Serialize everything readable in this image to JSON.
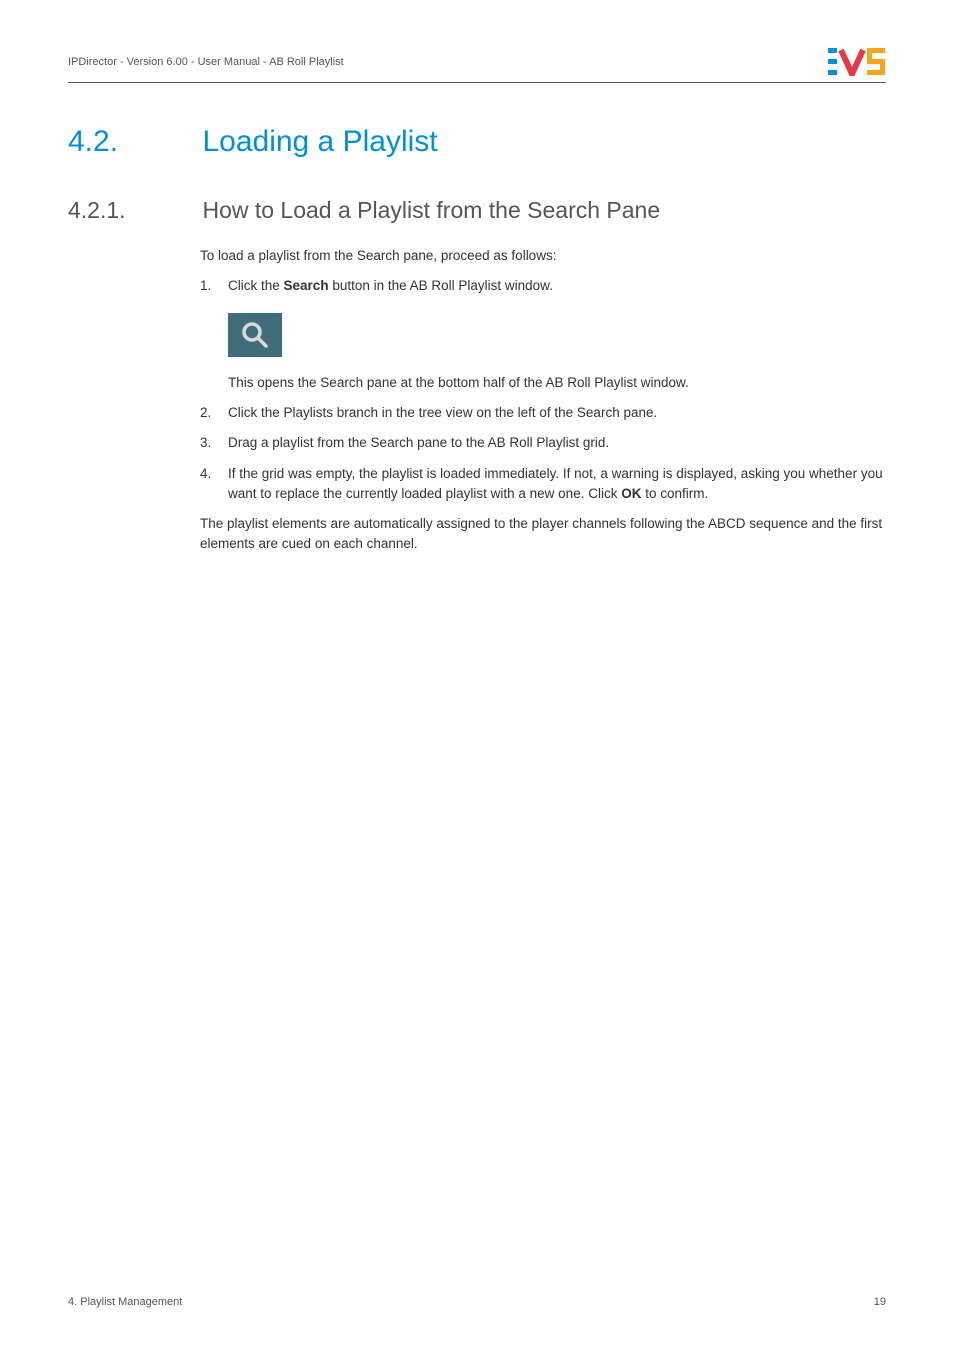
{
  "header": {
    "breadcrumb": "IPDirector - Version 6.00 - User Manual - AB Roll Playlist"
  },
  "section": {
    "number": "4.2.",
    "title": "Loading a Playlist"
  },
  "subsection": {
    "number": "4.2.1.",
    "title": "How to Load a Playlist from the Search Pane"
  },
  "intro": "To load a playlist from the Search pane, proceed as follows:",
  "steps": {
    "s1_prefix": "Click the ",
    "s1_bold": "Search",
    "s1_suffix": " button in the AB Roll Playlist window.",
    "s1_after": "This opens the Search pane at the bottom half of the AB Roll Playlist window.",
    "s2": "Click the Playlists branch in the tree view on the left of the Search pane.",
    "s3": "Drag a playlist from the Search pane to the AB Roll Playlist grid.",
    "s4_prefix": "If the grid was empty, the playlist is loaded immediately. If not, a warning is displayed, asking you whether you want to replace the currently loaded playlist with a new one. Click ",
    "s4_bold": "OK",
    "s4_suffix": " to confirm."
  },
  "outro": "The playlist elements are automatically assigned to the player channels following the ABCD sequence and the first elements are cued on each channel.",
  "footer": {
    "chapter": "4. Playlist Management",
    "page": "19"
  },
  "numbers": {
    "n1": "1.",
    "n2": "2.",
    "n3": "3.",
    "n4": "4."
  }
}
